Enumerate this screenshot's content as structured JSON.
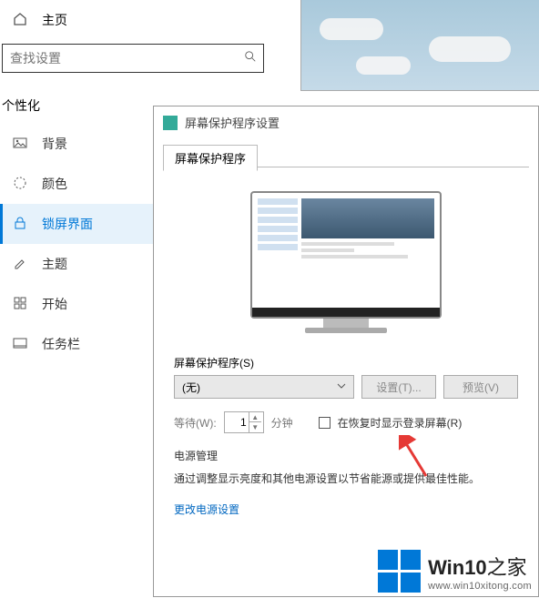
{
  "settings": {
    "home_label": "主页",
    "search": {
      "placeholder": "查找设置"
    },
    "category": "个性化",
    "nav": {
      "background": "背景",
      "colors": "颜色",
      "lockscreen": "锁屏界面",
      "themes": "主题",
      "start": "开始",
      "taskbar": "任务栏"
    }
  },
  "dialog": {
    "title": "屏幕保护程序设置",
    "tab_label": "屏幕保护程序",
    "screensaver": {
      "label": "屏幕保护程序(S)",
      "selected": "(无)"
    },
    "buttons": {
      "settings": "设置(T)...",
      "preview": "预览(V)"
    },
    "wait": {
      "label": "等待(W):",
      "value": "1",
      "unit": "分钟",
      "resume_label": "在恢复时显示登录屏幕(R)"
    },
    "power": {
      "title": "电源管理",
      "desc": "通过调整显示亮度和其他电源设置以节省能源或提供最佳性能。",
      "link": "更改电源设置"
    }
  },
  "watermark": {
    "brand_prefix": "Win10",
    "brand_suffix": "之家",
    "url": "www.win10xitong.com"
  }
}
